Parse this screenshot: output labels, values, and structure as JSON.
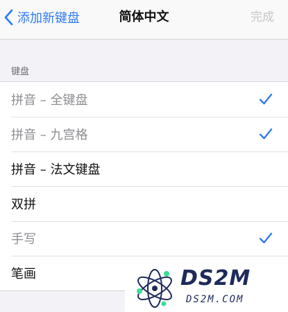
{
  "navbar": {
    "back_label": "添加新键盘",
    "title": "简体中文",
    "done_label": "完成",
    "accent_color": "#2f7cf6"
  },
  "section": {
    "header": "键盘"
  },
  "keyboards": [
    {
      "label": "拼音 – 全键盘",
      "checked": true,
      "disabled": true
    },
    {
      "label": "拼音 – 九宫格",
      "checked": true,
      "disabled": true
    },
    {
      "label": "拼音 – 法文键盘",
      "checked": false,
      "disabled": false
    },
    {
      "label": "双拼",
      "checked": false,
      "disabled": false
    },
    {
      "label": "手写",
      "checked": true,
      "disabled": true
    },
    {
      "label": "笔画",
      "checked": false,
      "disabled": false
    }
  ],
  "watermark": {
    "brand": "DS2M",
    "domain": "DS2M.COM"
  }
}
